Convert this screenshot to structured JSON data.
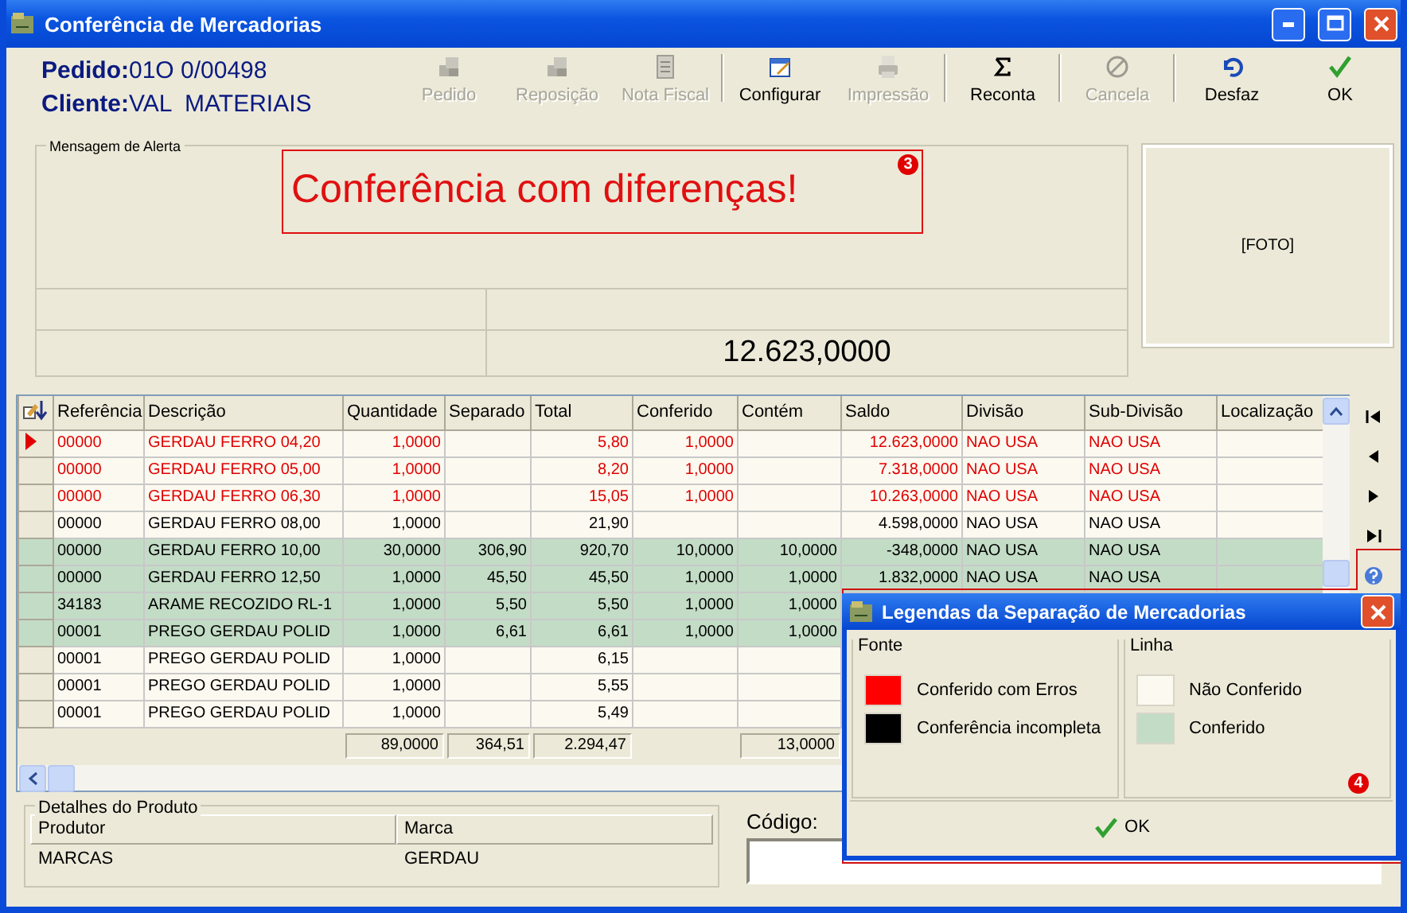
{
  "window": {
    "title": "Conferência de Mercadorias"
  },
  "order": {
    "pedido_label": "Pedido:",
    "pedido": "01O 0/00498",
    "cliente_label": "Cliente:",
    "cliente": "VAL  MATERIAIS"
  },
  "toolbar": {
    "groups": [
      {
        "buttons": [
          {
            "label": "Pedido",
            "disabled": true
          },
          {
            "label": "Reposição",
            "disabled": true
          },
          {
            "label": "Nota Fiscal",
            "disabled": true
          }
        ]
      },
      {
        "buttons": [
          {
            "label": "Configurar",
            "disabled": false
          },
          {
            "label": "Impressão",
            "disabled": true
          }
        ]
      },
      {
        "buttons": [
          {
            "label": "Reconta",
            "disabled": false
          }
        ]
      },
      {
        "buttons": [
          {
            "label": "Cancela",
            "disabled": true
          }
        ]
      },
      {
        "buttons": [
          {
            "label": "Desfaz",
            "disabled": false
          },
          {
            "label": "OK",
            "disabled": false
          }
        ]
      }
    ]
  },
  "alert": {
    "legend": "Mensagem de Alerta",
    "message": "Conferência com diferenças!",
    "badge": "3",
    "value": "12.623,0000"
  },
  "photo": {
    "label": "[FOTO]"
  },
  "grid": {
    "columns": [
      {
        "label": "Referência",
        "kind": "text"
      },
      {
        "label": "Descrição",
        "kind": "text"
      },
      {
        "label": "Quantidade",
        "kind": "number",
        "total": "89,0000"
      },
      {
        "label": "Separado",
        "kind": "number",
        "total": "364,51"
      },
      {
        "label": "Total",
        "kind": "number",
        "total": "2.294,47"
      },
      {
        "label": "Conferido",
        "kind": "number"
      },
      {
        "label": "Contém",
        "kind": "number",
        "total": "13,0000"
      },
      {
        "label": "Saldo",
        "kind": "number"
      },
      {
        "label": "Divisão",
        "kind": "text"
      },
      {
        "label": "Sub-Divisão",
        "kind": "text"
      },
      {
        "label": "Localização",
        "kind": "text"
      }
    ],
    "rows": [
      {
        "selected": true,
        "color": "#e00000",
        "checked": false,
        "cells": [
          "00000",
          "GERDAU FERRO 04,20",
          "1,0000",
          null,
          "5,80",
          "1,0000",
          null,
          "12.623,0000",
          "NAO USA",
          "NAO USA"
        ]
      },
      {
        "selected": false,
        "color": "#e00000",
        "checked": false,
        "cells": [
          "00000",
          "GERDAU FERRO 05,00",
          "1,0000",
          null,
          "8,20",
          "1,0000",
          null,
          "7.318,0000",
          "NAO USA",
          "NAO USA"
        ]
      },
      {
        "selected": false,
        "color": "#e00000",
        "checked": false,
        "cells": [
          "00000",
          "GERDAU FERRO 06,30",
          "1,0000",
          null,
          "15,05",
          "1,0000",
          null,
          "10.263,0000",
          "NAO USA",
          "NAO USA"
        ]
      },
      {
        "selected": false,
        "color": "#000000",
        "checked": false,
        "cells": [
          "00000",
          "GERDAU FERRO 08,00",
          "1,0000",
          null,
          "21,90",
          null,
          null,
          "4.598,0000",
          "NAO USA",
          "NAO USA"
        ]
      },
      {
        "selected": false,
        "color": "#000000",
        "checked": true,
        "cells": [
          "00000",
          "GERDAU FERRO 10,00",
          "30,0000",
          "306,90",
          "920,70",
          "10,0000",
          "10,0000",
          "-348,0000",
          "NAO USA",
          "NAO USA"
        ]
      },
      {
        "selected": false,
        "color": "#000000",
        "checked": true,
        "cells": [
          "00000",
          "GERDAU FERRO 12,50",
          "1,0000",
          "45,50",
          "45,50",
          "1,0000",
          "1,0000",
          "1.832,0000",
          "NAO USA",
          "NAO USA"
        ]
      },
      {
        "selected": false,
        "color": "#000000",
        "checked": true,
        "cells": [
          "34183",
          "ARAME RECOZIDO RL-1",
          "1,0000",
          "5,50",
          "5,50",
          "1,0000",
          "1,0000"
        ]
      },
      {
        "selected": false,
        "color": "#000000",
        "checked": true,
        "cells": [
          "00001",
          "PREGO GERDAU POLID",
          "1,0000",
          "6,61",
          "6,61",
          "1,0000",
          "1,0000"
        ]
      },
      {
        "selected": false,
        "color": "#000000",
        "checked": false,
        "cells": [
          "00001",
          "PREGO GERDAU POLID",
          "1,0000",
          null,
          "6,15"
        ]
      },
      {
        "selected": false,
        "color": "#000000",
        "checked": false,
        "cells": [
          "00001",
          "PREGO GERDAU POLID",
          "1,0000",
          null,
          "5,55"
        ]
      },
      {
        "selected": false,
        "color": "#000000",
        "checked": false,
        "cells": [
          "00001",
          "PREGO GERDAU POLID",
          "1,0000",
          null,
          "5,49"
        ]
      }
    ]
  },
  "navigation": {
    "buttons": [
      {
        "kind": "first"
      },
      {
        "kind": "previous"
      },
      {
        "kind": "next"
      },
      {
        "kind": "last"
      },
      {
        "kind": "help"
      }
    ]
  },
  "details": {
    "legend": "Detalhes do Produto",
    "columns": [
      "Produtor",
      "Marca"
    ],
    "values": [
      "MARCAS",
      "GERDAU"
    ]
  },
  "code": {
    "label": "Código:"
  },
  "legend_dialog": {
    "title": "Legendas da Separação de Mercadorias",
    "groups": [
      {
        "title": "Fonte",
        "items": [
          {
            "label": "Conferido com Erros",
            "color": "#ff0000"
          },
          {
            "label": "Conferência incompleta",
            "color": "#000000"
          }
        ]
      },
      {
        "title": "Linha",
        "items": [
          {
            "label": "Não Conferido",
            "color": "#fcf9f0"
          },
          {
            "label": "Conferido",
            "color": "#c3dcc6"
          }
        ]
      }
    ],
    "ok": "OK",
    "badge": "4"
  }
}
